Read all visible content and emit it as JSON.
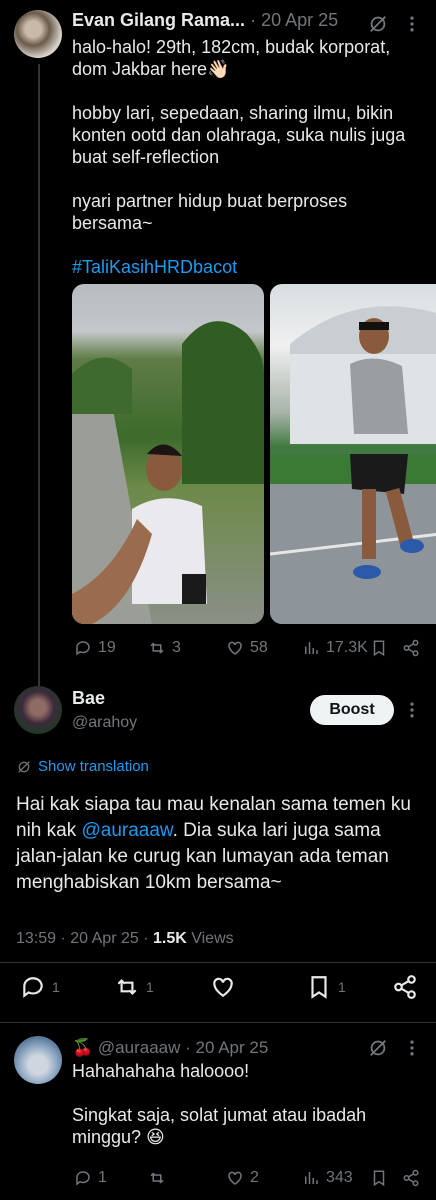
{
  "post1": {
    "author": "Evan Gilang Rama...",
    "date": "· 20 Apr 25",
    "paragraphs": [
      "halo-halo! 29th, 182cm, budak korporat, dom Jakbar here👋🏻",
      "hobby lari, sepedaan, sharing ilmu, bikin konten ootd dan olahraga, suka nulis juga buat self-reflection",
      "nyari partner hidup buat berproses bersama~"
    ],
    "hashtag": "#TaliKasihHRDbacot",
    "actions": {
      "replies": "19",
      "reposts": "3",
      "likes": "58",
      "views": "17.3K"
    }
  },
  "post2": {
    "author": "Bae",
    "handle": "@arahoy",
    "boost_label": "Boost",
    "translate_label": "Show translation",
    "text_before": "Hai kak siapa tau mau kenalan sama temen ku nih kak ",
    "mention": "@auraaaw",
    "text_after": ". Dia suka lari juga sama jalan-jalan ke curug kan lumayan ada teman menghabiskan 10km bersama~",
    "time": "13:59",
    "date": "20 Apr 25",
    "views_count": "1.5K",
    "views_label": "Views",
    "actions": {
      "replies": "1",
      "reposts": "1",
      "bookmarks": "1"
    }
  },
  "post3": {
    "emoji": "🍒",
    "handle": "@auraaaw",
    "date": "· 20 Apr 25",
    "paragraphs": [
      "Hahahahaha haloooo!",
      "Singkat saja, solat jumat atau ibadah minggu? 😆"
    ],
    "actions": {
      "replies": "1",
      "likes": "2",
      "views": "343"
    }
  },
  "colors": {
    "accent": "#1d9bf0",
    "muted": "#71767b",
    "background": "#000000",
    "text": "#e7e9ea"
  }
}
